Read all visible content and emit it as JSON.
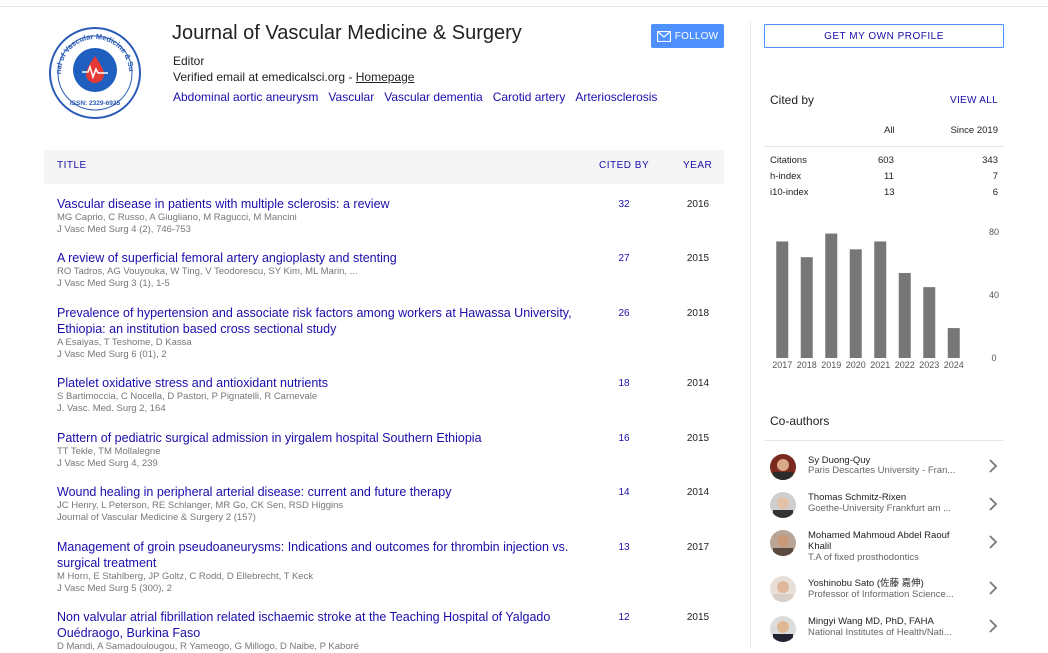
{
  "profile": {
    "name": "Journal of Vascular Medicine & Surgery",
    "affiliation": "Editor",
    "email_text": "Verified email at emedicalsci.org - ",
    "homepage": "Homepage",
    "logo_text": "Journal of Vascular Medicine & Surgery",
    "issn": "ISSN: 2329-6925",
    "interests": [
      "Abdominal aortic aneurysm",
      "Vascular",
      "Vascular dementia",
      "Carotid artery",
      "Arteriosclerosis"
    ],
    "follow_label": "FOLLOW"
  },
  "table": {
    "headers": {
      "title": "TITLE",
      "cited_by": "CITED BY",
      "year": "YEAR"
    },
    "rows": [
      {
        "title": "Vascular disease in patients with multiple sclerosis: a review",
        "authors": "MG Caprio, C Russo, A Giugliano, M Ragucci, M Mancini",
        "journal": "J Vasc Med Surg 4 (2), 746-753",
        "cited": "32",
        "year": "2016"
      },
      {
        "title": "A review of superficial femoral artery angioplasty and stenting",
        "authors": "RO Tadros, AG Vouyouka, W Ting, V Teodorescu, SY Kim, ML Marin, ...",
        "journal": "J Vasc Med Surg 3 (1), 1-5",
        "cited": "27",
        "year": "2015"
      },
      {
        "title": "Prevalence of hypertension and associate risk factors among workers at Hawassa University, Ethiopia: an institution based cross sectional study",
        "authors": "A Esaiyas, T Teshome, D Kassa",
        "journal": "J Vasc Med Surg 6 (01), 2",
        "cited": "26",
        "year": "2018"
      },
      {
        "title": "Platelet oxidative stress and antioxidant nutrients",
        "authors": "S Bartimoccia, C Nocella, D Pastori, P Pignatelli, R Carnevale",
        "journal": "J. Vasc. Med. Surg 2, 164",
        "cited": "18",
        "year": "2014"
      },
      {
        "title": "Pattern of pediatric surgical admission in yirgalem hospital Southern Ethiopia",
        "authors": "TT Tekle, TM Mollalegne",
        "journal": "J Vasc Med Surg 4, 239",
        "cited": "16",
        "year": "2015"
      },
      {
        "title": "Wound healing in peripheral arterial disease: current and future therapy",
        "authors": "JC Henry, L Peterson, RE Schlanger, MR Go, CK Sen, RSD Higgins",
        "journal": "Journal of Vascular Medicine & Surgery 2 (157)",
        "cited": "14",
        "year": "2014"
      },
      {
        "title": "Management of groin pseudoaneurysms: Indications and outcomes for thrombin injection vs. surgical treatment",
        "authors": "M Horn, E Stahlberg, JP Goltz, C Rodd, D Ellebrecht, T Keck",
        "journal": "J Vasc Med Surg 5 (300), 2",
        "cited": "13",
        "year": "2017"
      },
      {
        "title": "Non valvular atrial fibrillation related ischaemic stroke at the Teaching Hospital of Yalgado Ouédraogo, Burkina Faso",
        "authors": "D Mandi, A Samadoulougou, R Yameogo, G Millogo, D Naibe, P Kaboré",
        "journal": "",
        "cited": "12",
        "year": "2015"
      }
    ]
  },
  "sidebar": {
    "profile_button": "GET MY OWN PROFILE",
    "cited_by_title": "Cited by",
    "view_all": "VIEW ALL",
    "cite_headers": {
      "all": "All",
      "since": "Since 2019"
    },
    "cite_rows": [
      {
        "label": "Citations",
        "all": "603",
        "since": "343"
      },
      {
        "label": "h-index",
        "all": "11",
        "since": "7"
      },
      {
        "label": "i10-index",
        "all": "13",
        "since": "6"
      }
    ],
    "coauthors_title": "Co-authors",
    "coauthors": [
      {
        "name": "Sy Duong-Quy",
        "affiliation": "Paris Descartes University - Fran..."
      },
      {
        "name": "Thomas Schmitz-Rixen",
        "affiliation": "Goethe-University Frankfurt am ..."
      },
      {
        "name": "Mohamed Mahmoud Abdel Raouf Khalil",
        "affiliation": "T.A of fixed prosthodontics"
      },
      {
        "name": "Yoshinobu Sato (佐藤 嘉伸)",
        "affiliation": "Professor of Information Science..."
      },
      {
        "name": "Mingyi Wang MD, PhD, FAHA",
        "affiliation": "National Institutes of Health/Nati..."
      }
    ]
  },
  "chart_data": {
    "type": "bar",
    "categories": [
      "2017",
      "2018",
      "2019",
      "2020",
      "2021",
      "2022",
      "2023",
      "2024"
    ],
    "values": [
      74,
      64,
      79,
      69,
      74,
      54,
      45,
      19
    ],
    "ylim": [
      0,
      80
    ],
    "yticks": [
      "80",
      "40",
      "0"
    ],
    "bar_color": "#777777",
    "grid": false
  },
  "colors": {
    "link": "#1a0dab",
    "accent": "#4d90fe"
  }
}
